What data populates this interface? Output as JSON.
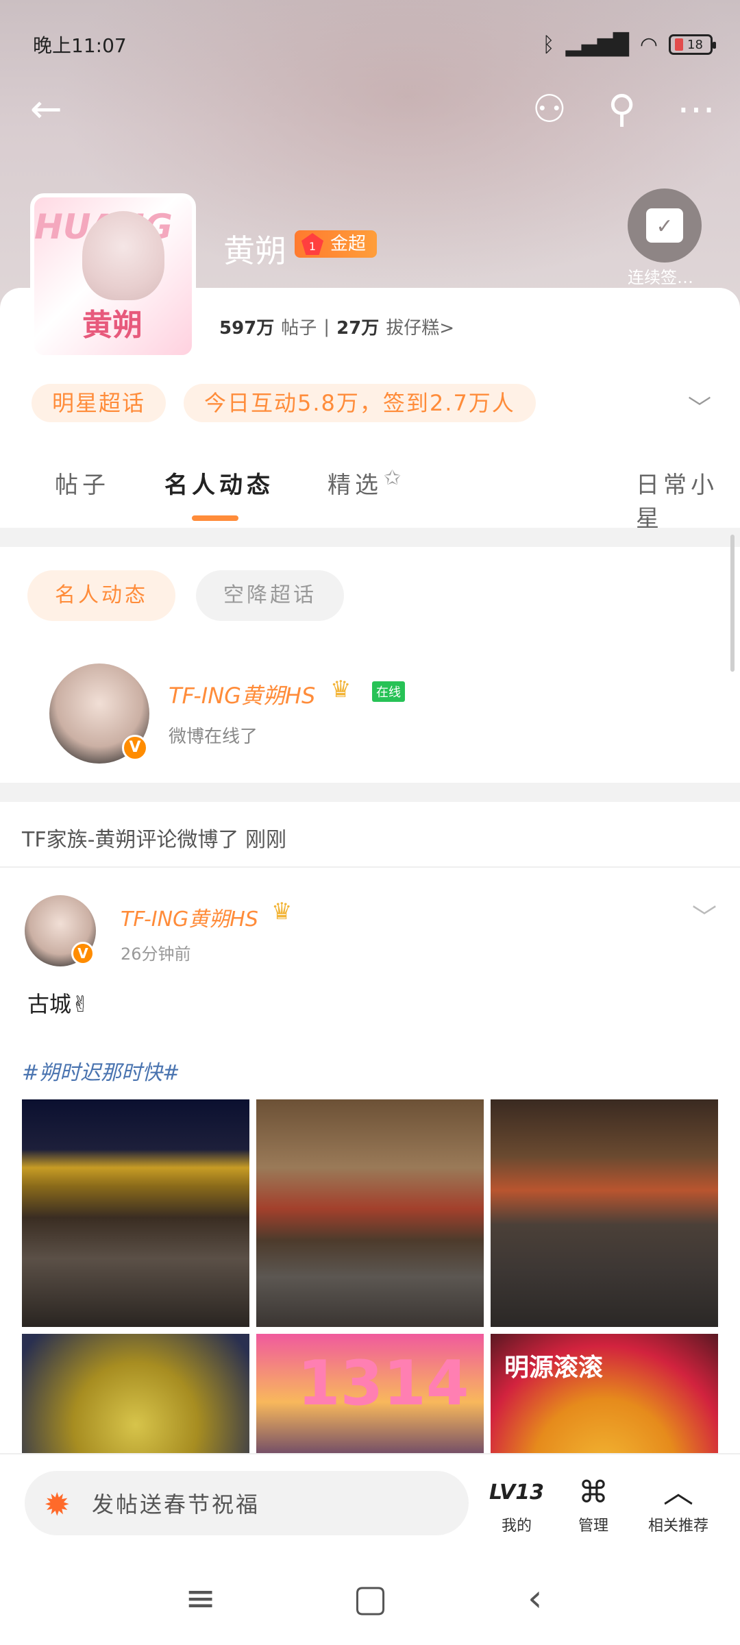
{
  "status_bar": {
    "time": "晚上11:07",
    "battery": "18"
  },
  "community": {
    "avatar_text": "黄朔",
    "avatar_banner": "HUANG",
    "name": "黄朔",
    "badge": "金超",
    "badge_level": "1",
    "checkin_label": "连续签…",
    "stats": {
      "posts_num": "597万",
      "posts_label": "帖子",
      "separator": "|",
      "fans_num": "27万",
      "fans_label": "拔仔糕>"
    },
    "pills": [
      "明星超话",
      "今日互动5.8万，签到2.7万人"
    ]
  },
  "tabs": [
    {
      "label": "帖子",
      "active": false
    },
    {
      "label": "名人动态",
      "active": true
    },
    {
      "label": "精选",
      "active": false
    },
    {
      "label": "日常小星",
      "active": false
    }
  ],
  "subtabs": [
    {
      "label": "名人动态",
      "active": true
    },
    {
      "label": "空降超话",
      "active": false
    }
  ],
  "online": {
    "name": "TF-ING黄朔HS",
    "tag": "在线",
    "status": "微博在线了"
  },
  "comment_line": "TF家族-黄朔评论微博了  刚刚",
  "post": {
    "author": "TF-ING黄朔HS",
    "time": "26分钟前",
    "text": "古城✌",
    "hashtag": "#朔时迟那时快#",
    "photo_labels": [
      "",
      "",
      "",
      "",
      "1314",
      "明源滚滚"
    ]
  },
  "bottom": {
    "input_placeholder": "发帖送春节祝福",
    "nav": [
      {
        "icon": "LV13",
        "label": "我的"
      },
      {
        "icon": "⌘",
        "label": "管理"
      },
      {
        "icon": "︿",
        "label": "相关推荐"
      }
    ]
  },
  "colors": {
    "accent": "#ff8c3a",
    "badge_gradient_start": "#ff7a2f",
    "online_green": "#27c256",
    "hashtag_blue": "#4a74b0"
  }
}
